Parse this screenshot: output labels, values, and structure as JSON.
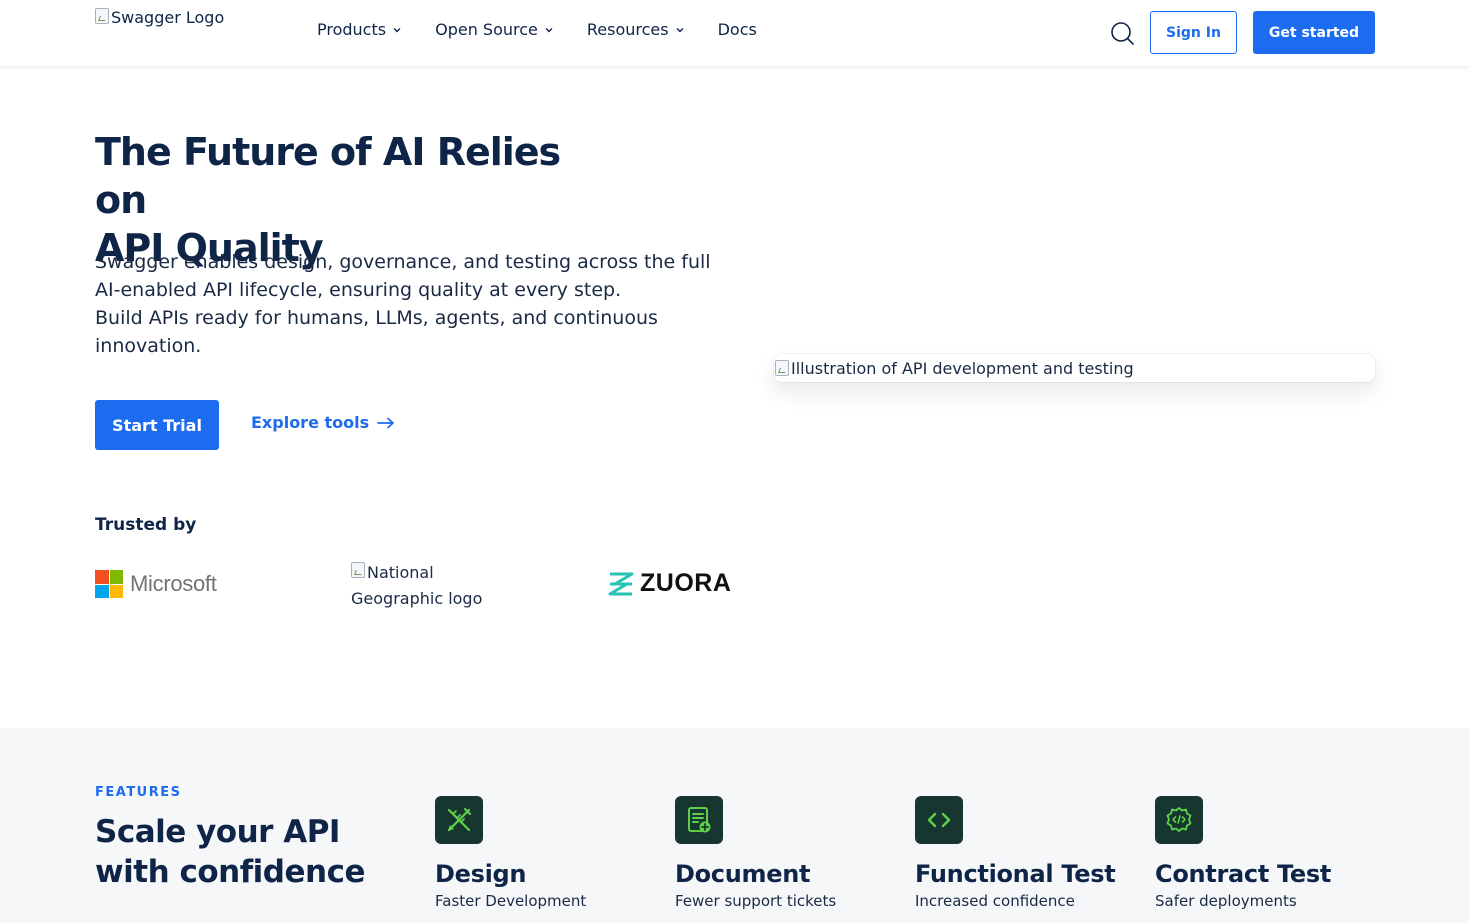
{
  "header": {
    "logo_alt": "Swagger Logo",
    "nav": [
      {
        "label": "Products",
        "has_dropdown": true
      },
      {
        "label": "Open Source",
        "has_dropdown": true
      },
      {
        "label": "Resources",
        "has_dropdown": true
      },
      {
        "label": "Docs",
        "has_dropdown": false
      }
    ],
    "sign_in_label": "Sign In",
    "get_started_label": "Get started"
  },
  "hero": {
    "title_line1": "The Future of AI Relies on",
    "title_line2": "API Quality",
    "description_p1": "Swagger enables design, governance, and testing across the full AI-enabled API lifecycle, ensuring quality at every step.",
    "description_p2": "Build APIs ready for humans, LLMs, agents, and continuous innovation.",
    "start_trial_label": "Start Trial",
    "explore_label": "Explore tools",
    "image_alt": "Illustration of API development and testing"
  },
  "trusted": {
    "label": "Trusted by",
    "logos": {
      "microsoft": "Microsoft",
      "natgeo_alt": "National Geographic logo",
      "zuora": "ZUORA"
    }
  },
  "features": {
    "eyebrow": "FEATURES",
    "title": "Scale your API with confidence",
    "items": [
      {
        "title": "Design",
        "subtitle": "Faster Development",
        "icon": "design-tools-icon"
      },
      {
        "title": "Document",
        "subtitle": "Fewer support tickets",
        "icon": "document-add-icon"
      },
      {
        "title": "Functional Test",
        "subtitle": "Increased confidence",
        "icon": "code-brackets-icon"
      },
      {
        "title": "Contract Test",
        "subtitle": "Safer deployments",
        "icon": "code-gear-icon"
      }
    ]
  },
  "colors": {
    "primary": "#1d6cf0",
    "navy": "#0f2548",
    "feature_icon_bg": "#173630",
    "feature_icon_fg": "#5ed14a",
    "features_bg": "#f6f7f9"
  }
}
